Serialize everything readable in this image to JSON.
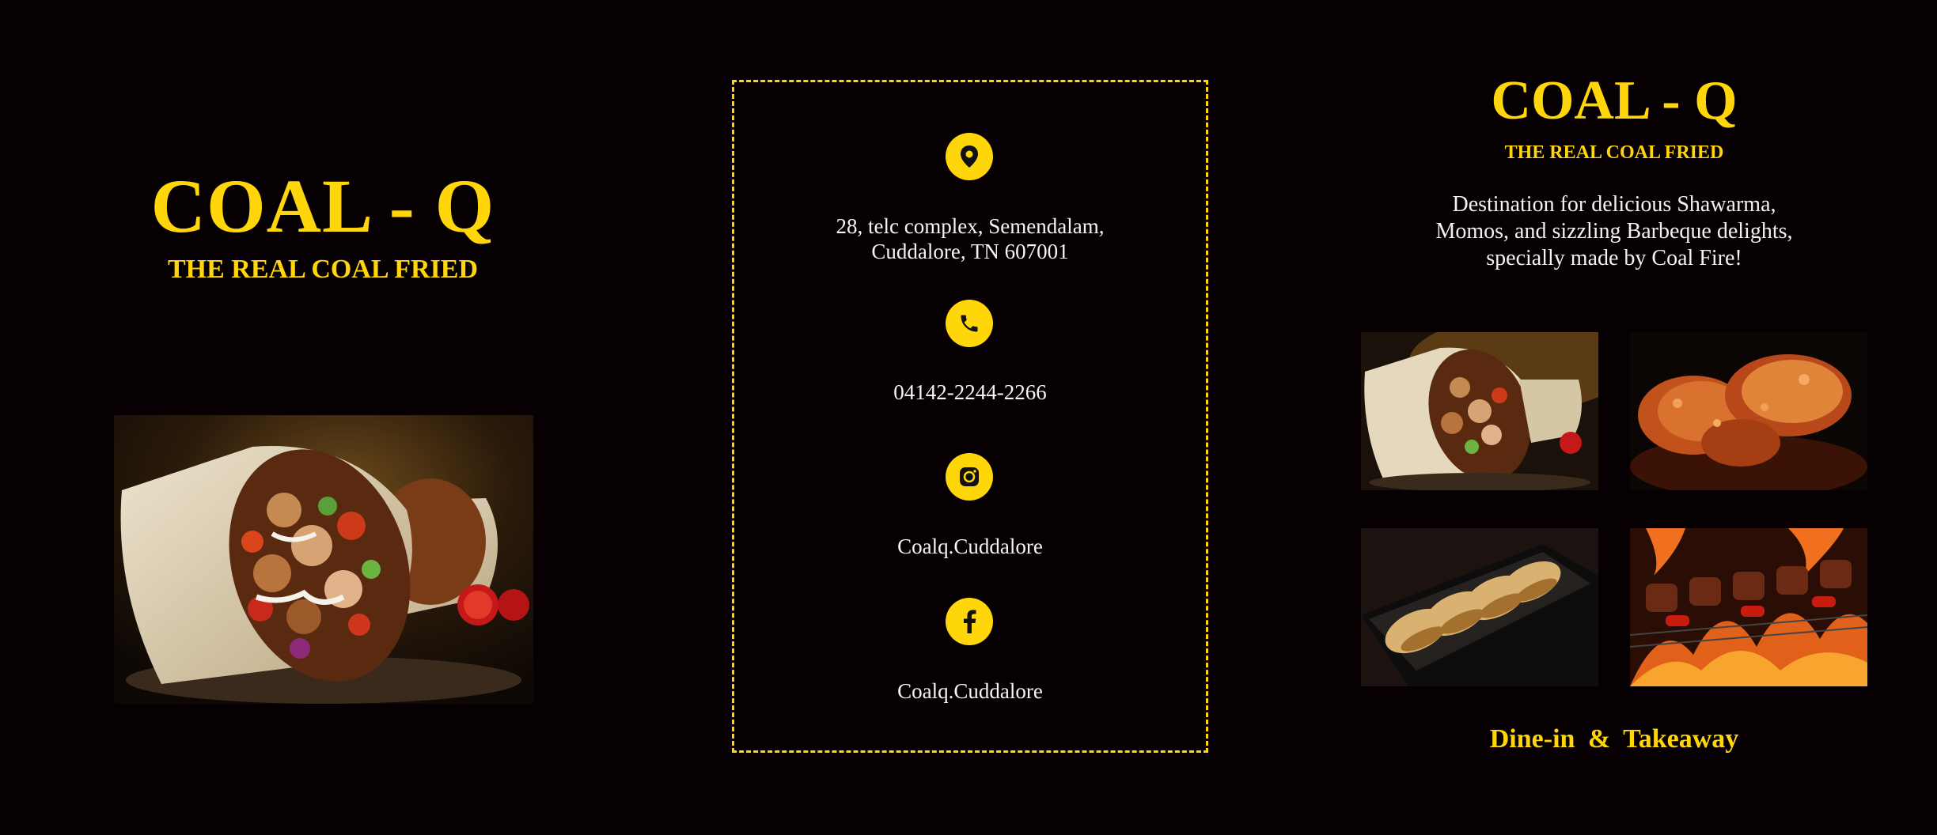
{
  "left": {
    "title": "COAL - Q",
    "subtitle": "THE REAL COAL FRIED"
  },
  "contact": {
    "address_line1": "28, telc complex, Semendalam,",
    "address_line2": "Cuddalore, TN 607001",
    "phone": "04142-2244-2266",
    "instagram": "Coalq.Cuddalore",
    "facebook": "Coalq.Cuddalore",
    "icons": [
      "location-pin-icon",
      "phone-icon",
      "instagram-icon",
      "facebook-icon"
    ]
  },
  "right": {
    "title": "COAL - Q",
    "subtitle": "THE REAL COAL FRIED",
    "description_line1": "Destination for delicious Shawarma,",
    "description_line2": "Momos, and sizzling Barbeque delights,",
    "description_line3": "specially made by Coal Fire!",
    "footer": "Dine-in  &  Takeaway"
  },
  "colors": {
    "background": "#060002",
    "accent": "#ffd60a",
    "text": "#ffffff"
  }
}
